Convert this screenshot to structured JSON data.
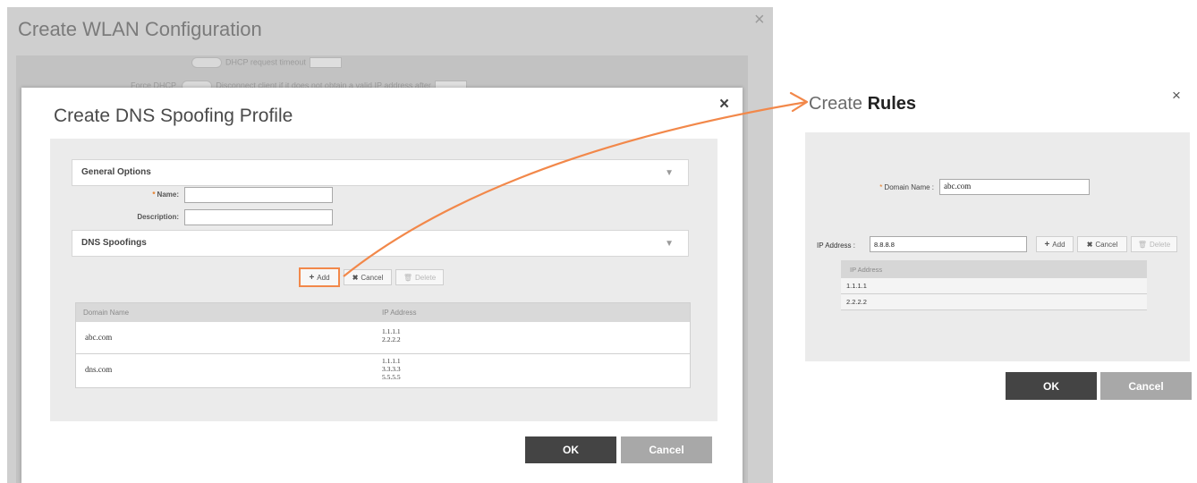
{
  "wlan": {
    "title": "Create WLAN Configuration",
    "close": "×",
    "ghost_rows": [
      "DHCP request timeout",
      "Force DHCP",
      "Disconnect client if it does not obtain a valid IP address after"
    ]
  },
  "dns_profile": {
    "title": "Create DNS Spoofing Profile",
    "close": "×",
    "general_options": {
      "label": "General Options",
      "caret": "▼",
      "name_label": "Name:",
      "name_required": "*",
      "name_value": "",
      "description_label": "Description:",
      "description_value": ""
    },
    "dns_spoofings": {
      "label": "DNS Spoofings",
      "caret": "▼",
      "toolbar": {
        "add": "Add",
        "add_icon": "+",
        "cancel": "Cancel",
        "cancel_icon": "✖",
        "delete": "Delete",
        "delete_icon": "🗑"
      },
      "columns": [
        "Domain Name",
        "IP Address"
      ],
      "rows": [
        {
          "domain": "abc.com",
          "ips": [
            "1.1.1.1",
            "2.2.2.2"
          ]
        },
        {
          "domain": "dns.com",
          "ips": [
            "1.1.1.1",
            "3.3.3.3",
            "5.5.5.5"
          ]
        }
      ]
    },
    "ok_label": "OK",
    "cancel_label": "Cancel"
  },
  "rules": {
    "title_prefix": "Create",
    "title_bold": "Rules",
    "close": "×",
    "domain_label": "Domain Name :",
    "domain_required": "*",
    "domain_value": "abc.com",
    "ip_label": "IP Address :",
    "ip_value": "8.8.8.8",
    "toolbar": {
      "add": "Add",
      "add_icon": "+",
      "cancel": "Cancel",
      "cancel_icon": "✖",
      "delete": "Delete",
      "delete_icon": "🗑"
    },
    "column": "IP Address",
    "rows": [
      "1.1.1.1",
      "2.2.2.2"
    ],
    "ok_label": "OK",
    "cancel_label": "Cancel"
  },
  "colors": {
    "arrow": "#f2884a",
    "ok_button": "#444444",
    "cancel_button": "#a8a8a8"
  }
}
